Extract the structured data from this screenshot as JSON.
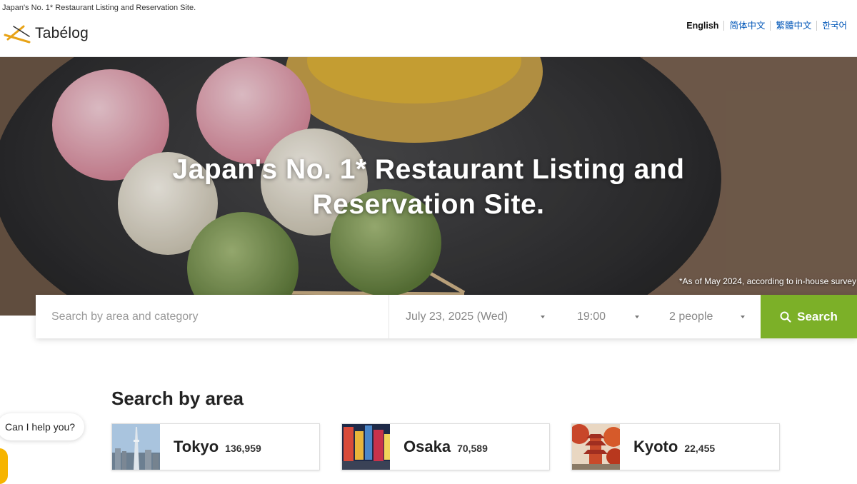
{
  "header": {
    "tagline": "Japan's No. 1* Restaurant Listing and Reservation Site.",
    "logo_text": "Tabélog",
    "languages": [
      {
        "label": "English",
        "active": true
      },
      {
        "label": "简体中文",
        "active": false
      },
      {
        "label": "繁體中文",
        "active": false
      },
      {
        "label": "한국어",
        "active": false
      }
    ]
  },
  "hero": {
    "title_line1": "Japan's No. 1* Restaurant Listing and",
    "title_line2": "Reservation Site.",
    "footnote": "*As of May 2024, according to in-house survey"
  },
  "search": {
    "placeholder": "Search by area and category",
    "date": "July 23, 2025 (Wed)",
    "time": "19:00",
    "people": "2 people",
    "button_label": "Search"
  },
  "area": {
    "heading": "Search by area",
    "cards": [
      {
        "name": "Tokyo",
        "count": "136,959",
        "image_icon": "tokyo-skyline-photo"
      },
      {
        "name": "Osaka",
        "count": "70,589",
        "image_icon": "osaka-street-photo"
      },
      {
        "name": "Kyoto",
        "count": "22,455",
        "image_icon": "kyoto-pagoda-photo"
      }
    ]
  },
  "chat": {
    "label": "Can I help you?"
  },
  "colors": {
    "accent_green": "#7cb028",
    "link_blue": "#0056b8",
    "chat_yellow": "#f6b400",
    "logo_gold": "#e8a317"
  }
}
